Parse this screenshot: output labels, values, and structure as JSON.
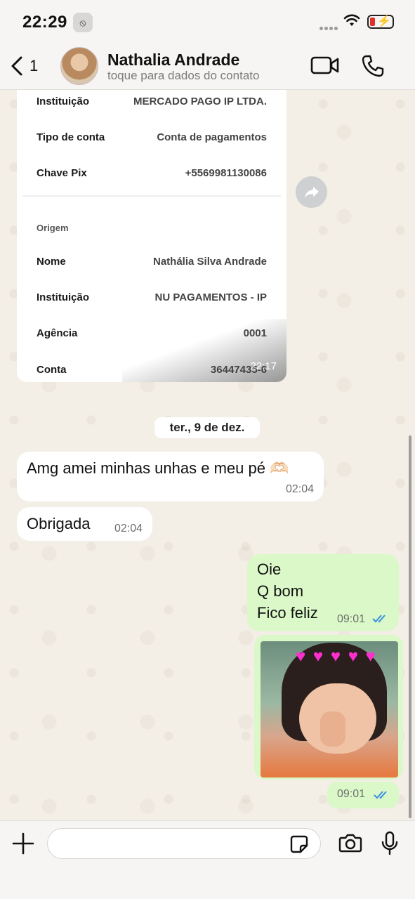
{
  "status_bar": {
    "time": "22:29"
  },
  "header": {
    "back_count": "1",
    "contact_name": "Nathalia Andrade",
    "contact_subtitle": "toque para dados do contato"
  },
  "receipt": {
    "rows": [
      {
        "label": "Instituição",
        "value": "MERCADO PAGO IP LTDA."
      },
      {
        "label": "Tipo de conta",
        "value": "Conta de pagamentos"
      },
      {
        "label": "Chave Pix",
        "value": "+5569981130086"
      }
    ],
    "origin_section": "Origem",
    "origin_rows": [
      {
        "label": "Nome",
        "value": "Nathália Silva Andrade"
      },
      {
        "label": "Instituição",
        "value": "NU PAGAMENTOS - IP"
      },
      {
        "label": "Agência",
        "value": "0001"
      },
      {
        "label": "Conta",
        "value": "36447435-6"
      }
    ],
    "time": "22:17"
  },
  "date_separator": "ter., 9 de dez.",
  "messages": [
    {
      "direction": "in",
      "text": "Amg amei minhas unhas e meu pé 🫶🏻",
      "time": "02:04"
    },
    {
      "direction": "in",
      "text": "Obrigada",
      "time": "02:04"
    },
    {
      "direction": "out",
      "text": "Oie\nQ bom\nFico feliz",
      "time": "09:01",
      "status": "read"
    },
    {
      "direction": "out",
      "type": "image",
      "time": "09:01",
      "status": "read"
    }
  ],
  "input": {
    "placeholder": "",
    "value": ""
  },
  "colors": {
    "outgoing_bubble": "#dbf8c8",
    "incoming_bubble": "#ffffff",
    "read_ticks": "#3a8fe0"
  }
}
